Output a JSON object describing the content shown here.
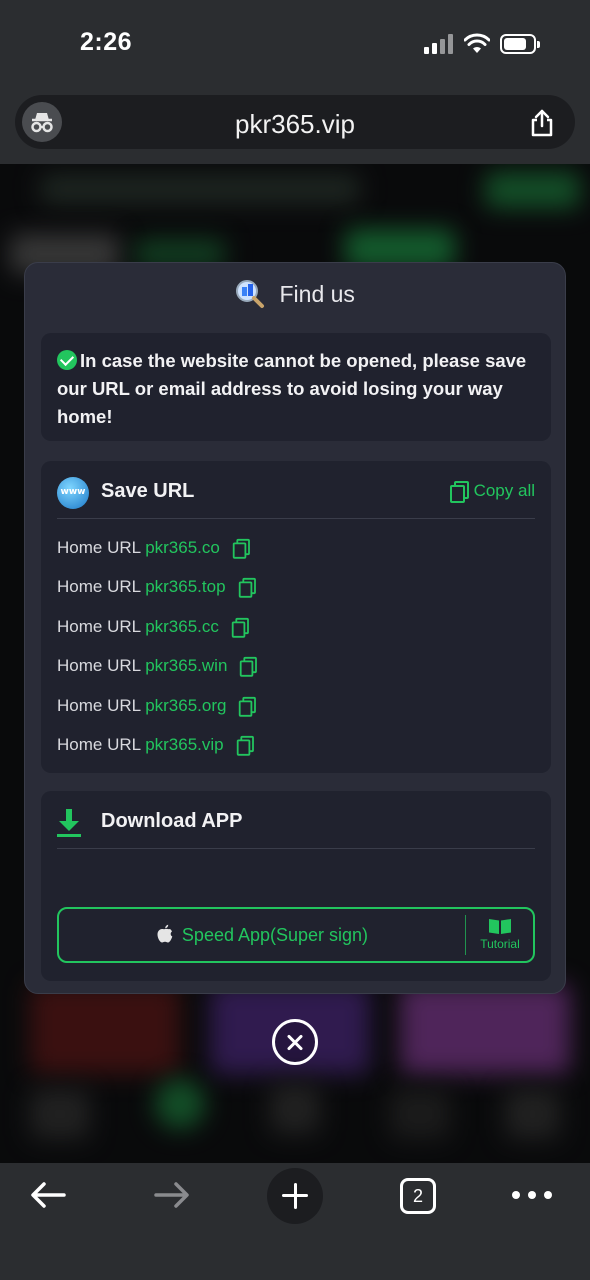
{
  "status_bar": {
    "time": "2:26"
  },
  "browser": {
    "url": "pkr365.vip",
    "tab_count": "2"
  },
  "modal": {
    "title": "Find us",
    "notice": "In case the website cannot be opened, please save our URL or email address to avoid losing your way home!",
    "save_url": {
      "title": "Save URL",
      "copy_all": "Copy all",
      "globe_text": "www",
      "urls": [
        {
          "label": "Home URL",
          "value": "pkr365.co"
        },
        {
          "label": "Home URL",
          "value": "pkr365.top"
        },
        {
          "label": "Home URL",
          "value": "pkr365.cc"
        },
        {
          "label": "Home URL",
          "value": "pkr365.win"
        },
        {
          "label": "Home URL",
          "value": "pkr365.org"
        },
        {
          "label": "Home URL",
          "value": "pkr365.vip"
        }
      ]
    },
    "download": {
      "title": "Download APP",
      "app_button": "Speed App(Super sign)",
      "tutorial": "Tutorial"
    }
  },
  "colors": {
    "accent": "#22c55e",
    "modal_bg": "#2a2c38",
    "card_bg": "#20222e",
    "toolbar_bg": "#2b2d30"
  }
}
